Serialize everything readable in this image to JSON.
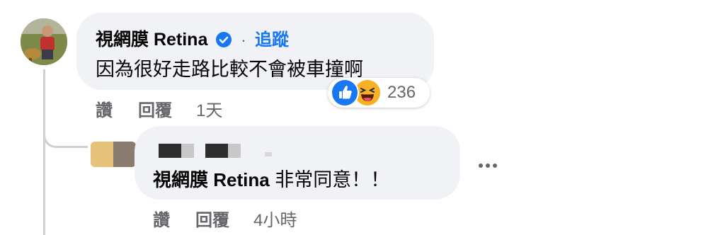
{
  "comment": {
    "author": "視網膜 Retina",
    "verified": true,
    "separator": "·",
    "follow_label": "追蹤",
    "text": "因為很好走路比較不會被車撞啊",
    "actions": {
      "like": "讚",
      "reply": "回覆",
      "time": "1天"
    },
    "reactions": {
      "types": [
        "like-icon",
        "haha-icon"
      ],
      "count": "236"
    }
  },
  "reply": {
    "mention": "視網膜 Retina",
    "text": " 非常同意！！",
    "actions": {
      "like": "讚",
      "reply": "回覆",
      "time": "4小時"
    }
  },
  "colors": {
    "bubble": "#f0f2f5",
    "link": "#1877f2",
    "secondary_text": "#65676b",
    "like_blue": "#1877f2",
    "haha_yellow": "#f7b125"
  }
}
